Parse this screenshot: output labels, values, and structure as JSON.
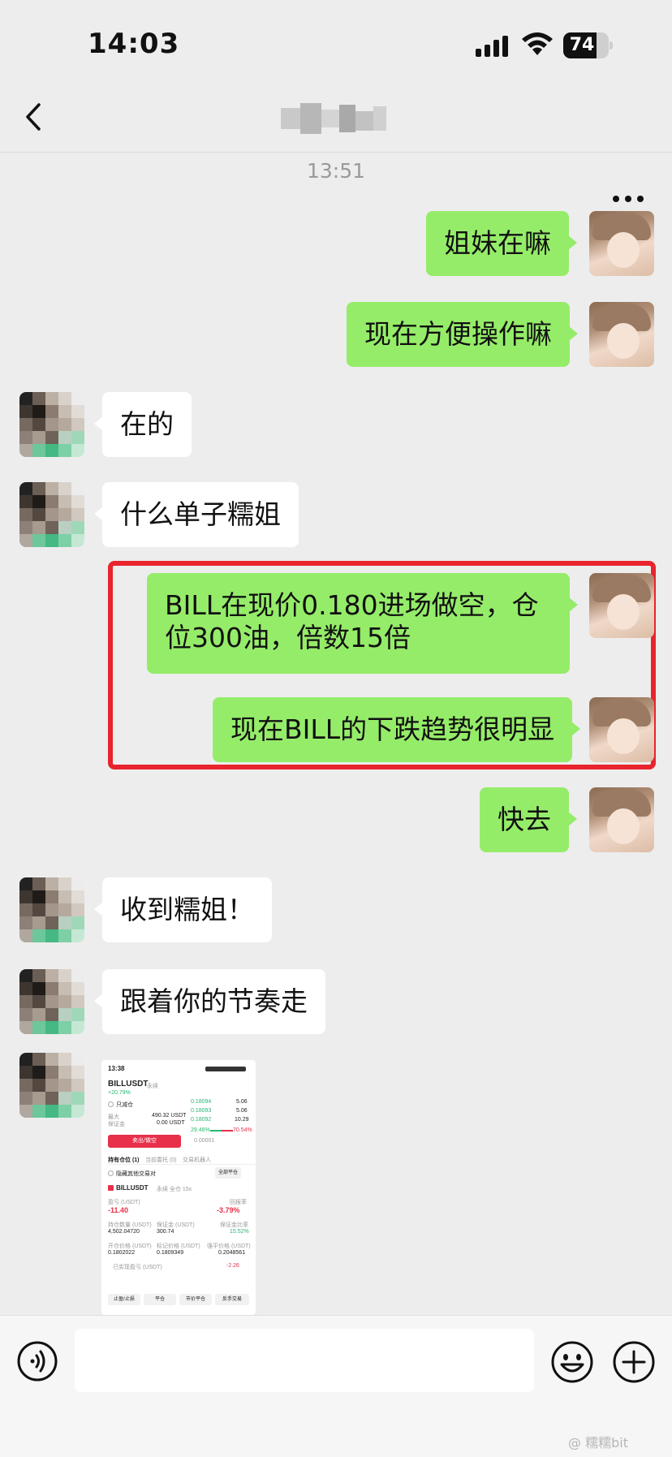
{
  "status_bar": {
    "time": "14:03",
    "battery": "74",
    "battery_level": 0.74
  },
  "nav": {
    "back_icon": "chevron-left-icon",
    "title": "",
    "more_icon": "more-dots-icon"
  },
  "timestamp": "13:51",
  "messages": [
    {
      "from": "me",
      "text": "姐妹在嘛"
    },
    {
      "from": "me",
      "text": "现在方便操作嘛"
    },
    {
      "from": "other",
      "text": "在的"
    },
    {
      "from": "other",
      "text": "什么单子糯姐"
    },
    {
      "from": "me",
      "text": "BILL在现价0.180进场做空，仓位300油，倍数15倍",
      "highlighted": true
    },
    {
      "from": "me",
      "text": "现在BILL的下跌趋势很明显",
      "highlighted": true
    },
    {
      "from": "me",
      "text": "快去"
    },
    {
      "from": "other",
      "text": "收到糯姐！"
    },
    {
      "from": "other",
      "text": "跟着你的节奏走"
    }
  ],
  "highlight_color": "#e8242c",
  "bubble_colors": {
    "me": "#95ec69",
    "other": "#ffffff"
  },
  "screenshot": {
    "time": "13:38",
    "pair": "BILLUSDT",
    "contract_tag": "永续",
    "change": "+20.79%",
    "only_reduce": "只减仓",
    "max_label": "最大",
    "max_value": "490.32 USDT",
    "margin_label": "保证金",
    "margin_value": "0.00 USDT",
    "book_rows": [
      {
        "price": "0.18094",
        "qty": "5.06"
      },
      {
        "price": "0.18093",
        "qty": "5.06"
      },
      {
        "price": "0.18092",
        "qty": "10.29"
      }
    ],
    "bid_pct": "29.46%",
    "ask_pct": "70.54%",
    "tick": "0.00001",
    "sell_button": "卖出/做空",
    "tabs": [
      "持有仓位 (1)",
      "当前委托 (0)",
      "交易机器人"
    ],
    "hide_other": "隐藏其他交易对",
    "close_all": "全部平仓",
    "position_pair": "BILLUSDT",
    "position_tags": "永续 全仓 15x",
    "pnl_label": "盈亏 (USDT)",
    "pnl_value": "-11.40",
    "roi_label": "回报率",
    "roi_value": "-3.79%",
    "size_label": "持仓数量 (USDT)",
    "size_value": "4,502.04720",
    "margin2_label": "保证金 (USDT)",
    "margin2_value": "300.74",
    "margin_ratio_label": "保证金比率",
    "margin_ratio_value": "15.52%",
    "entry_label": "开仓价格 (USDT)",
    "entry_value": "0.1802022",
    "mark_label": "标记价格 (USDT)",
    "mark_value": "0.1809349",
    "liq_label": "强平价格 (USDT)",
    "liq_value": "0.2048561",
    "realized_label": "已实现盈亏 (USDT)",
    "realized_value": "-2.26",
    "actions": [
      "止盈/止损",
      "平仓",
      "市价平仓",
      "反手交易"
    ]
  },
  "input_bar": {
    "placeholder": "",
    "voice_icon": "voice-icon",
    "emoji_icon": "emoji-icon",
    "plus_icon": "plus-icon"
  },
  "watermark": "@ 糯糯bit"
}
